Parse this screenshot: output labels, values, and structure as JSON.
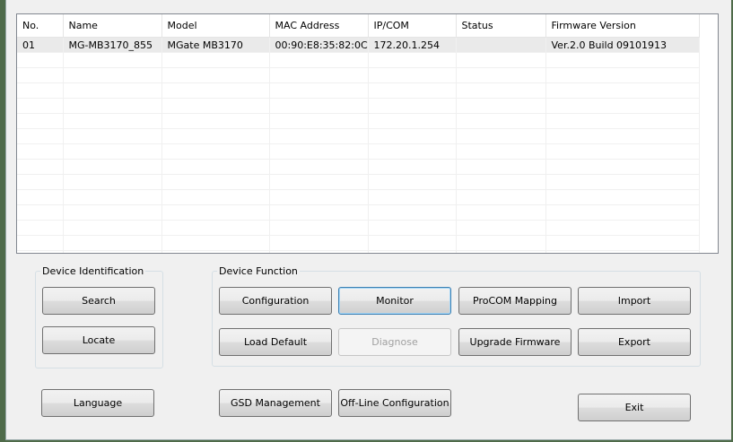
{
  "device_list": {
    "columns": [
      "No.",
      "Name",
      "Model",
      "MAC Address",
      "IP/COM",
      "Status",
      "Firmware Version"
    ],
    "rows": [
      [
        "01",
        "MG-MB3170_855",
        "MGate MB3170",
        "00:90:E8:35:82:0C",
        "172.20.1.254",
        "",
        "Ver.2.0 Build 09101913"
      ]
    ]
  },
  "device_identification": {
    "title": "Device Identification",
    "search_label": "Search",
    "locate_label": "Locate"
  },
  "device_function": {
    "title": "Device Function",
    "configuration_label": "Configuration",
    "monitor_label": "Monitor",
    "procom_mapping_label": "ProCOM Mapping",
    "import_label": "Import",
    "load_default_label": "Load Default",
    "diagnose_label": "Diagnose",
    "upgrade_firmware_label": "Upgrade Firmware",
    "export_label": "Export"
  },
  "bottom": {
    "language_label": "Language",
    "gsd_management_label": "GSD Management",
    "offline_configuration_label": "Off-Line Configuration",
    "exit_label": "Exit"
  }
}
